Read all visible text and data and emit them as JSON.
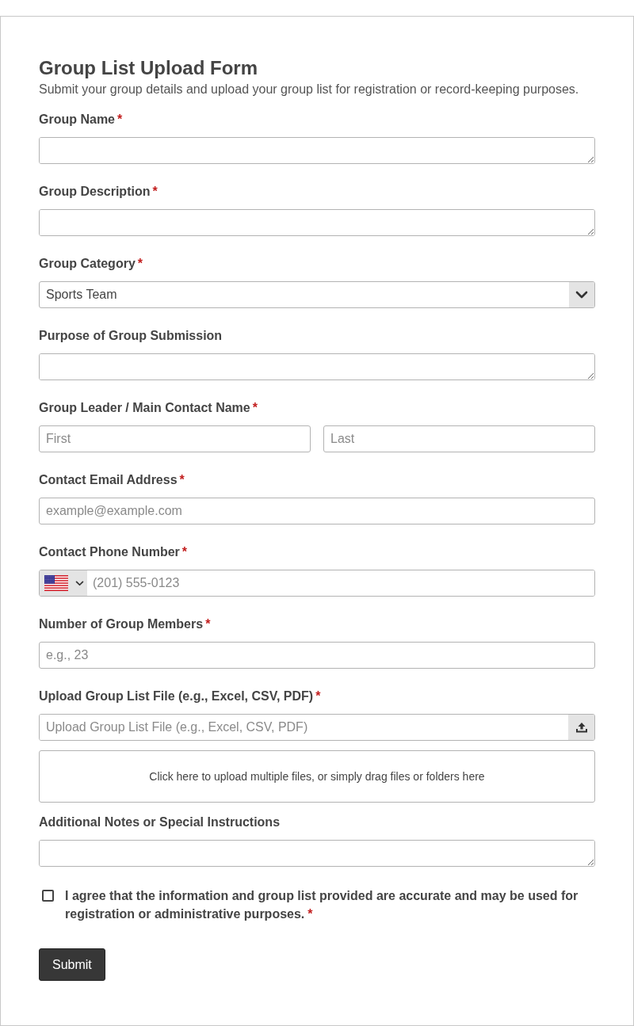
{
  "form": {
    "title": "Group List Upload Form",
    "description": "Submit your group details and upload your group list for registration or record-keeping purposes."
  },
  "fields": [
    {
      "kind": "textarea",
      "label": "Group Name",
      "required_mark": "*"
    },
    {
      "kind": "textarea",
      "label": "Group Description",
      "required_mark": "*"
    },
    {
      "kind": "select",
      "label": "Group Category",
      "required_mark": "*",
      "value": "Sports Team"
    },
    {
      "kind": "textarea",
      "label": "Purpose of Group Submission"
    },
    {
      "kind": "name",
      "label": "Group Leader / Main Contact Name",
      "required_mark": "*",
      "inputs": [
        {
          "placeholder": "First"
        },
        {
          "placeholder": "Last"
        }
      ]
    },
    {
      "kind": "text",
      "label": "Contact Email Address",
      "required_mark": "*",
      "placeholder": "example@example.com"
    },
    {
      "kind": "phone",
      "label": "Contact Phone Number",
      "required_mark": "*",
      "placeholder": "(201) 555-0123"
    },
    {
      "kind": "text",
      "label": "Number of Group Members",
      "required_mark": "*",
      "placeholder": "e.g., 23"
    },
    {
      "kind": "file",
      "label": "Upload Group List File (e.g., Excel, CSV, PDF)",
      "required_mark": "*",
      "placeholder": "Upload Group List File (e.g., Excel, CSV, PDF)",
      "dropzone": "Click here to upload multiple files, or simply drag files or folders here"
    },
    {
      "kind": "textarea",
      "label": "Additional Notes or Special Instructions"
    }
  ],
  "agreement": {
    "text": "I agree that the information and group list provided are accurate and may be used for registration or administrative purposes.",
    "required_mark": "*",
    "checked": false
  },
  "submit": "Submit"
}
